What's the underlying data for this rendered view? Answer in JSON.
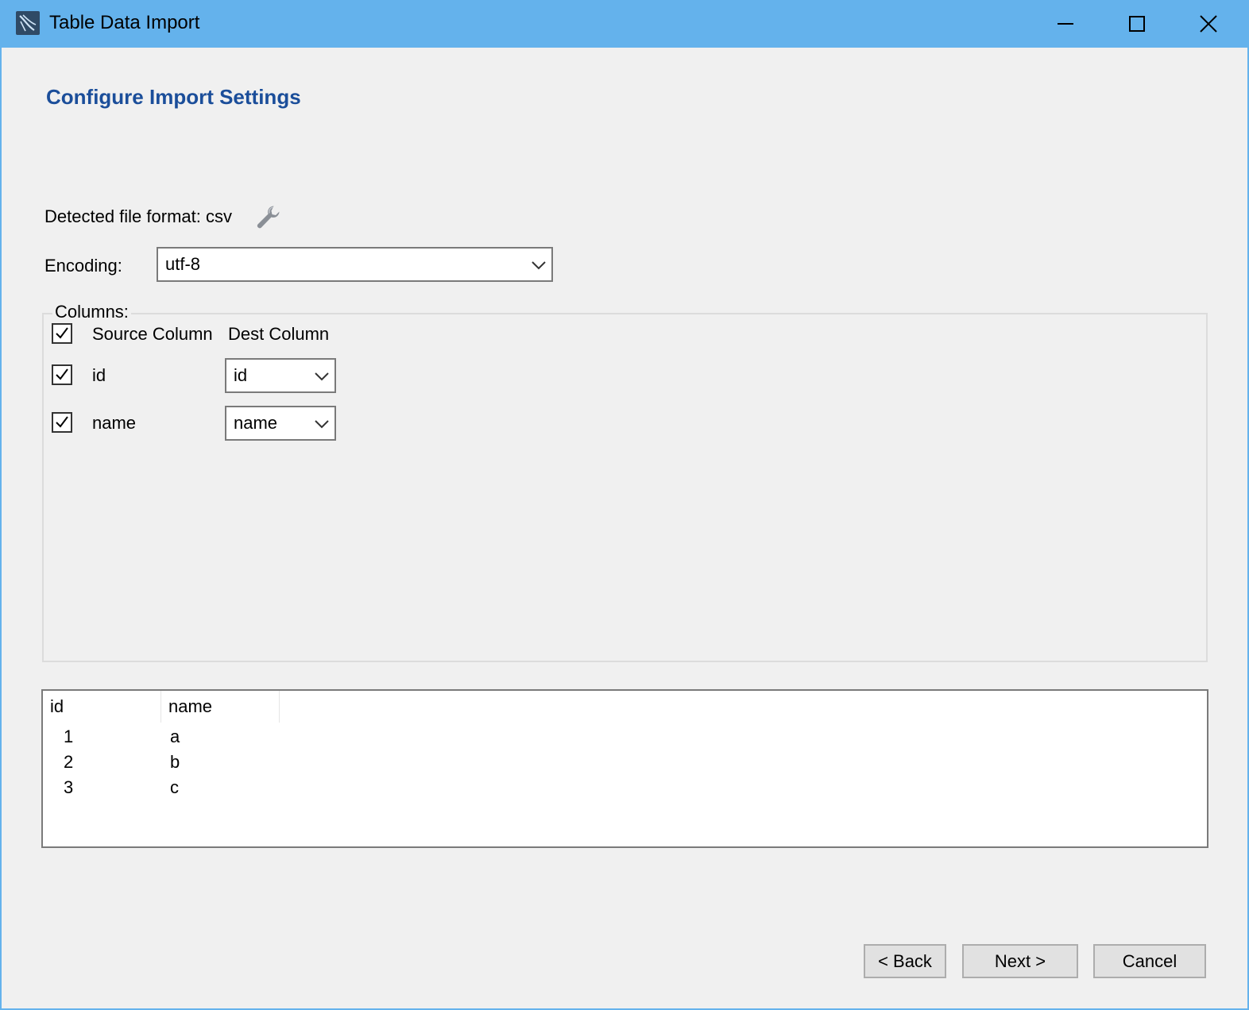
{
  "window": {
    "title": "Table Data Import",
    "controls": [
      "minimize-icon",
      "maximize-icon",
      "close-icon"
    ],
    "title_bar_color": "#64b2ec"
  },
  "page": {
    "heading": "Configure Import Settings",
    "heading_color": "#1b4e9a"
  },
  "format": {
    "label": "Detected file format: csv",
    "icon": "wrench-icon"
  },
  "encoding": {
    "label": "Encoding:",
    "value": "utf-8"
  },
  "columns": {
    "group_label": "Columns:",
    "header": {
      "checked": true,
      "source_label": "Source Column",
      "dest_label": "Dest Column"
    },
    "rows": [
      {
        "checked": true,
        "source": "id",
        "dest": "id"
      },
      {
        "checked": true,
        "source": "name",
        "dest": "name"
      }
    ]
  },
  "preview": {
    "headers": [
      "id",
      "name"
    ],
    "rows": [
      [
        "1",
        "a"
      ],
      [
        "2",
        "b"
      ],
      [
        "3",
        "c"
      ]
    ]
  },
  "buttons": {
    "back": "< Back",
    "next": "Next >",
    "cancel": "Cancel"
  }
}
